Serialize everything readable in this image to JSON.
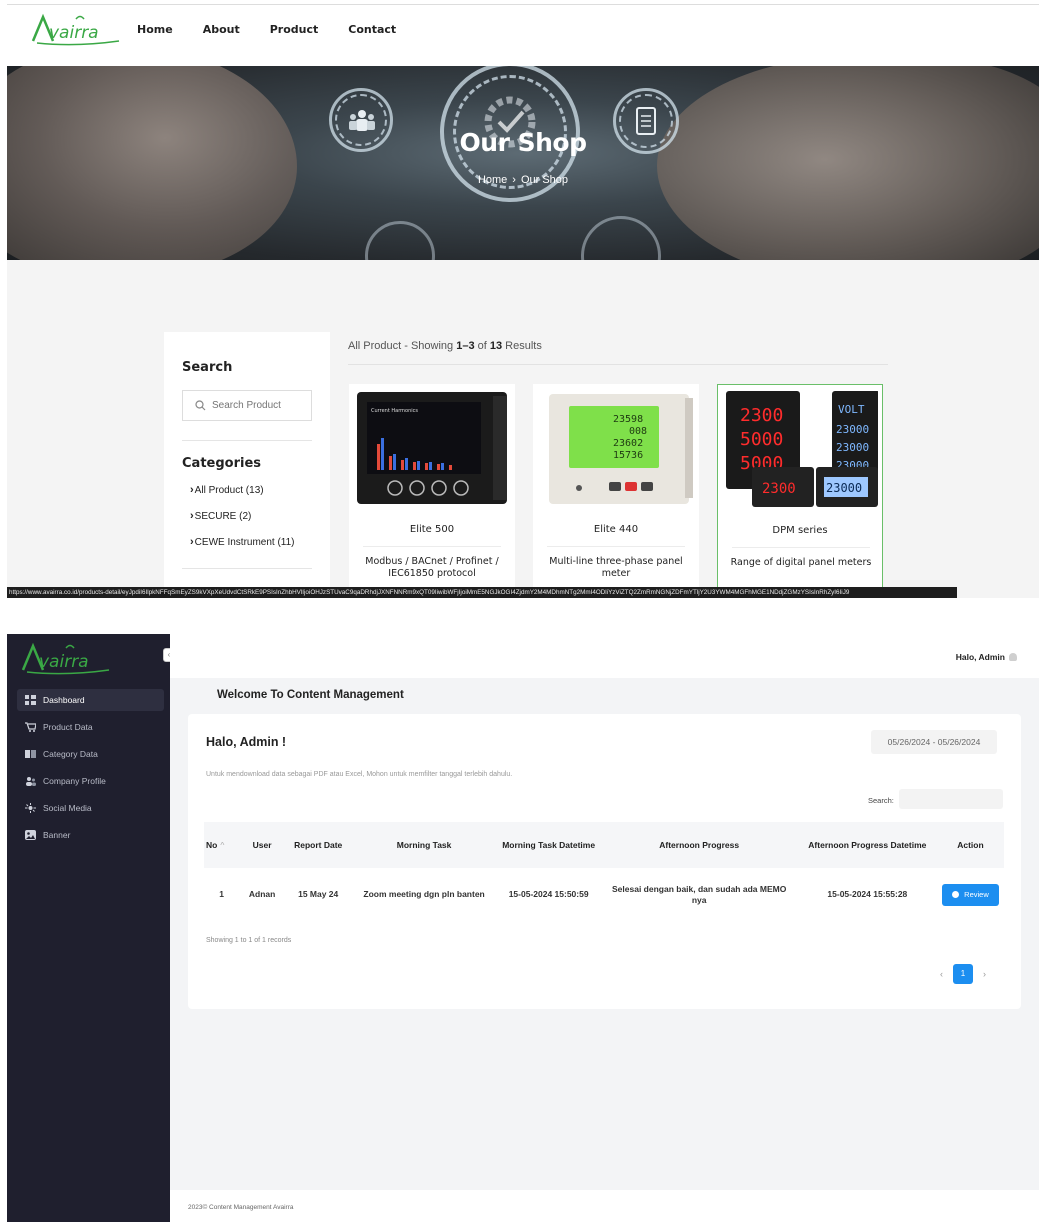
{
  "shop": {
    "logo_text": "Avairra",
    "nav": [
      "Home",
      "About",
      "Product",
      "Contact"
    ],
    "hero": {
      "title": "Our Shop",
      "breadcrumb": [
        "Home",
        "Our Shop"
      ]
    },
    "sidebar": {
      "search_heading": "Search",
      "search_placeholder": "Search Product",
      "categories_heading": "Categories",
      "categories": [
        "All Product (13)",
        "SECURE (2)",
        "CEWE Instrument (11)"
      ]
    },
    "results": {
      "prefix": "All Product - Showing ",
      "range": "1–3",
      "of": " of ",
      "total": "13",
      "suffix": " Results"
    },
    "products": [
      {
        "name": "Elite 500",
        "desc": "Modbus / BACnet / Profinet / IEC61850 protocol"
      },
      {
        "name": "Elite 440",
        "desc": "Multi-line three-phase panel meter"
      },
      {
        "name": "DPM series",
        "desc": "Range of digital panel meters"
      }
    ],
    "status_url": "https://www.avairra.co.id/products-detail/eyJpdiI6IlpkNFFqSmEyZS9kVXpXeUdvdCtSRkE9PSIsInZhbHVlIjoiOHJzSTUvaC9qaDRhdjJXNFNNRm9xQT09IiwibWFjIjoiMmE5NGJkOGI4ZjdmY2M4MDhmNTg2MmI4ODliYzViZTQ2ZmRmNGNjZDFmYTljY2U3YWM4MGFhMGE1NDdjZGMzYSIsInRhZyI6IiJ9"
  },
  "admin": {
    "logo_text": "Avairra",
    "collapse_icon": "chevron-left-icon",
    "menu": [
      {
        "label": "Dashboard",
        "icon": "dashboard-icon",
        "active": true
      },
      {
        "label": "Product Data",
        "icon": "cart-icon",
        "active": false
      },
      {
        "label": "Category Data",
        "icon": "book-icon",
        "active": false
      },
      {
        "label": "Company Profile",
        "icon": "users-icon",
        "active": false
      },
      {
        "label": "Social Media",
        "icon": "share-icon",
        "active": false
      },
      {
        "label": "Banner",
        "icon": "image-icon",
        "active": false
      }
    ],
    "topbar_user": "Halo, Admin",
    "page_heading": "Welcome To Content Management",
    "panel_title": "Halo, Admin !",
    "date_range": "05/26/2024 - 05/26/2024",
    "note": "Untuk mendownload data sebagai PDF atau Excel, Mohon untuk memfilter tanggal terlebih dahulu.",
    "search_label": "Search:",
    "table": {
      "headers": [
        "No",
        "User",
        "Report Date",
        "Morning Task",
        "Morning Task Datetime",
        "Afternoon Progress",
        "Afternoon Progress Datetime",
        "Action"
      ],
      "rows": [
        {
          "no": "1",
          "user": "Adnan",
          "report_date": "15 May 24",
          "morning_task": "Zoom meeting dgn pln banten",
          "morning_dt": "15-05-2024 15:50:59",
          "afternoon": "Selesai dengan baik, dan sudah ada MEMO nya",
          "afternoon_dt": "15-05-2024 15:55:28",
          "action": "Review"
        }
      ]
    },
    "info": "Showing 1 to 1 of 1 records",
    "page": "1",
    "footer": "2023© Content Management Avairra",
    "colors": {
      "sidebar": "#1f1f2e",
      "accent": "#1c8ef0",
      "brand_green": "#3aa845"
    }
  }
}
